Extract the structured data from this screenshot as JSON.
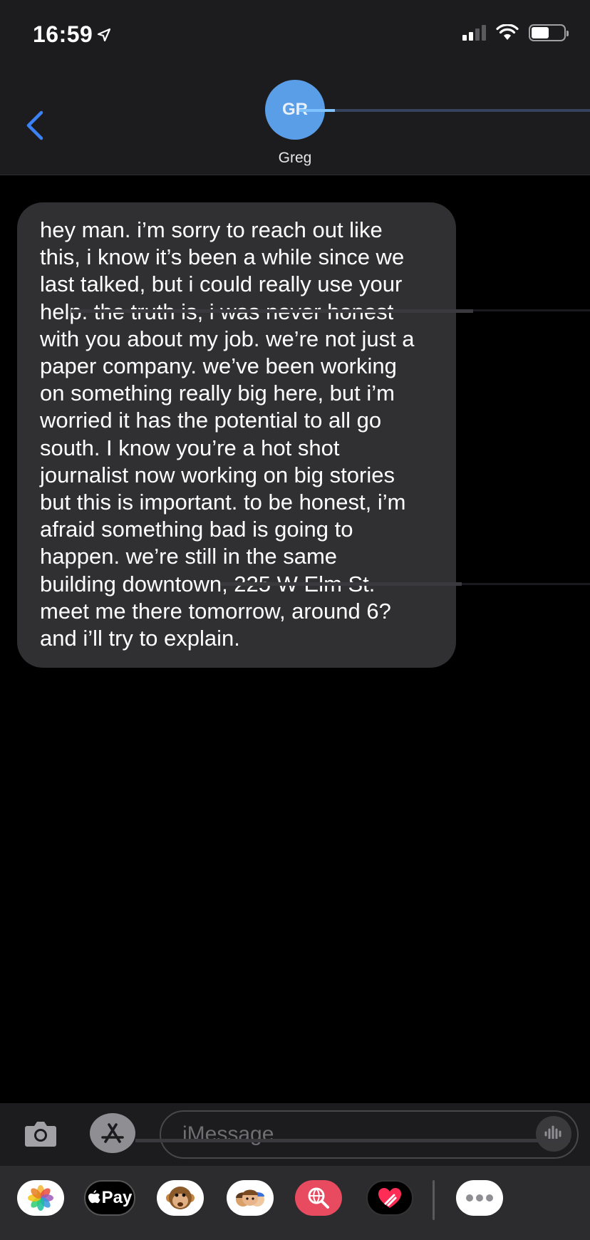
{
  "status_bar": {
    "time": "16:59",
    "location_icon": "location-arrow-icon",
    "signal_icon": "cellular-signal-icon",
    "wifi_icon": "wifi-icon",
    "battery_level": 0.55
  },
  "header": {
    "back_icon": "chevron-left-icon",
    "avatar_initials": "GR",
    "contact_name": "Greg"
  },
  "message": {
    "direction": "incoming",
    "text": "hey man. i’m sorry to reach out like\nthis, i know it’s been a while since we\nlast talked, but i could really use your\nhelp. the truth is, i was never honest\nwith you about my job. we’re not just a\npaper company. we’ve been working\non something really big here, but i’m\nworried it has the potential to all go\nsouth. I know you’re a hot shot\njournalist now working on big stories\nbut this is important. to be honest, i’m\nafraid something bad is going to\nhappen. we’re still in the same\nbuilding downtown, 225 W Elm St.\nmeet me there tomorrow, around 6?\nand i’ll try to explain."
  },
  "input_bar": {
    "camera_icon": "camera-icon",
    "apps_icon": "app-store-icon",
    "placeholder": "iMessage",
    "audio_icon": "audio-waveform-icon"
  },
  "app_drawer": {
    "apps": [
      {
        "name": "photos-app-icon",
        "label": "Photos"
      },
      {
        "name": "apple-pay-app-icon",
        "label": " Pay"
      },
      {
        "name": "animoji-app-icon",
        "label": "Animoji"
      },
      {
        "name": "memoji-app-icon",
        "label": "Memoji"
      },
      {
        "name": "image-search-app-icon",
        "label": "#images"
      },
      {
        "name": "digital-touch-app-icon",
        "label": "Digital Touch"
      },
      {
        "name": "more-apps-icon",
        "label": "More"
      }
    ]
  },
  "colors": {
    "header_bg": "#1c1c1e",
    "bubble_bg": "#303033",
    "accent_blue": "#3b82f6",
    "avatar_bg": "#5a9ee8"
  }
}
